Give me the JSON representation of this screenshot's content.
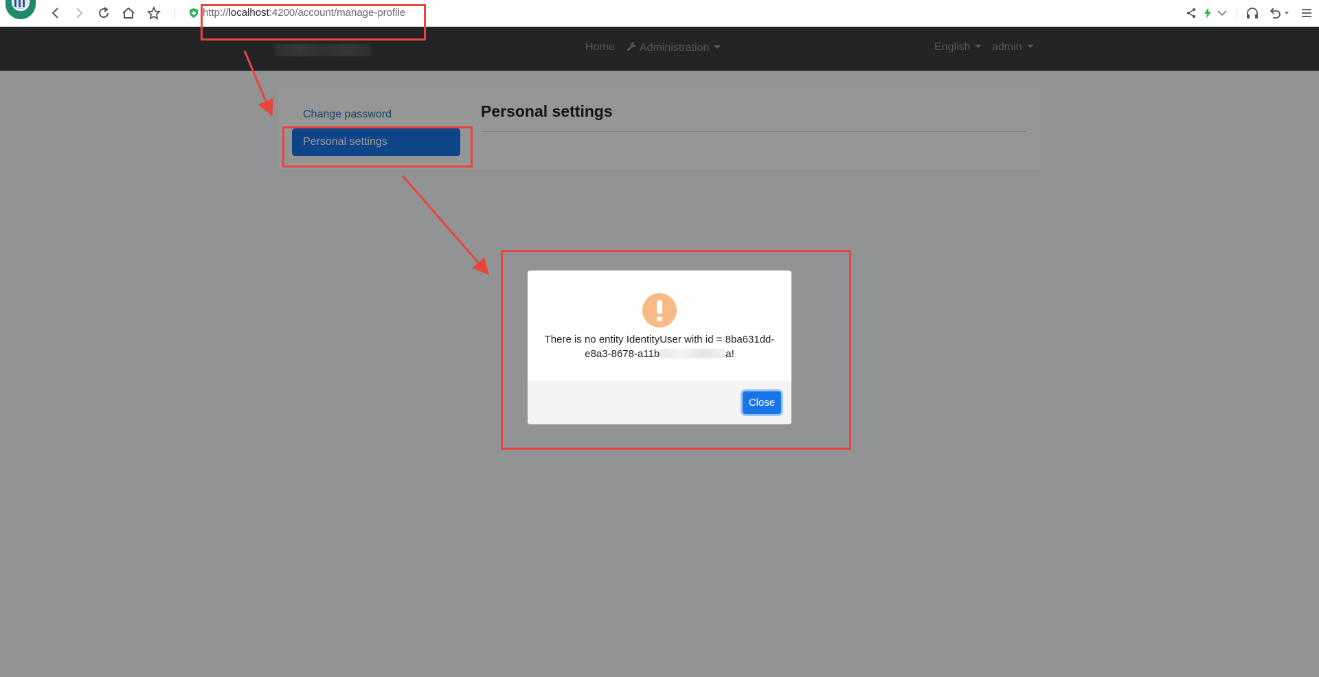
{
  "browser": {
    "url_scheme": "http://",
    "url_host": "localhost",
    "url_rest": ":4200/account/manage-profile"
  },
  "navbar": {
    "home": "Home",
    "administration": "Administration",
    "language": "English",
    "user": "admin"
  },
  "sidebar": {
    "items": [
      {
        "label": "Change password"
      },
      {
        "label": "Personal settings",
        "active": true
      }
    ]
  },
  "main": {
    "title": "Personal settings"
  },
  "modal": {
    "message_line1": "There is no entity IdentityUser with id = 8ba631dd-",
    "message_line2_start": "e8a3-8678-a11b",
    "message_line2_end": "a!",
    "close_label": "Close",
    "icon": "warning-icon",
    "icon_color": "#f8bb86"
  },
  "colors": {
    "accent": "#1976e6",
    "navbar": "#3a3d40",
    "annotation": "#e8453c"
  }
}
